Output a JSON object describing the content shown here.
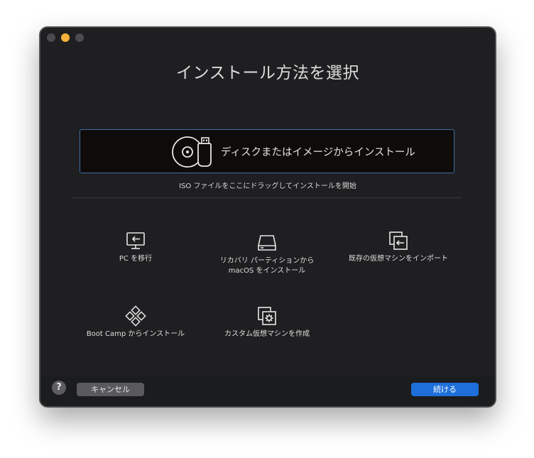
{
  "window": {
    "title": "インストール方法を選択"
  },
  "install_media": {
    "label": "ディスクまたはイメージからインストール",
    "icon": "disc-usb-icon"
  },
  "drop_hint": "ISO ファイルをここにドラッグしてインストールを開始",
  "options": [
    {
      "label": "PC を移行",
      "icon": "migrate-pc-icon"
    },
    {
      "label": "リカバリ パーティションから\nmacOS をインストール",
      "icon": "drive-icon"
    },
    {
      "label": "既存の仮想マシンをインポート",
      "icon": "import-vm-icon"
    },
    {
      "label": "Boot Camp からインストール",
      "icon": "bootcamp-icon"
    },
    {
      "label": "カスタム仮想マシンを作成",
      "icon": "custom-vm-icon"
    }
  ],
  "footer": {
    "help": "?",
    "cancel_label": "キャンセル",
    "continue_label": "続ける"
  },
  "colors": {
    "window_bg": "#1f1f21",
    "accent": "#1e6fd9",
    "selection_border": "#3c6fa8",
    "minimize_light": "#f5b13a"
  }
}
